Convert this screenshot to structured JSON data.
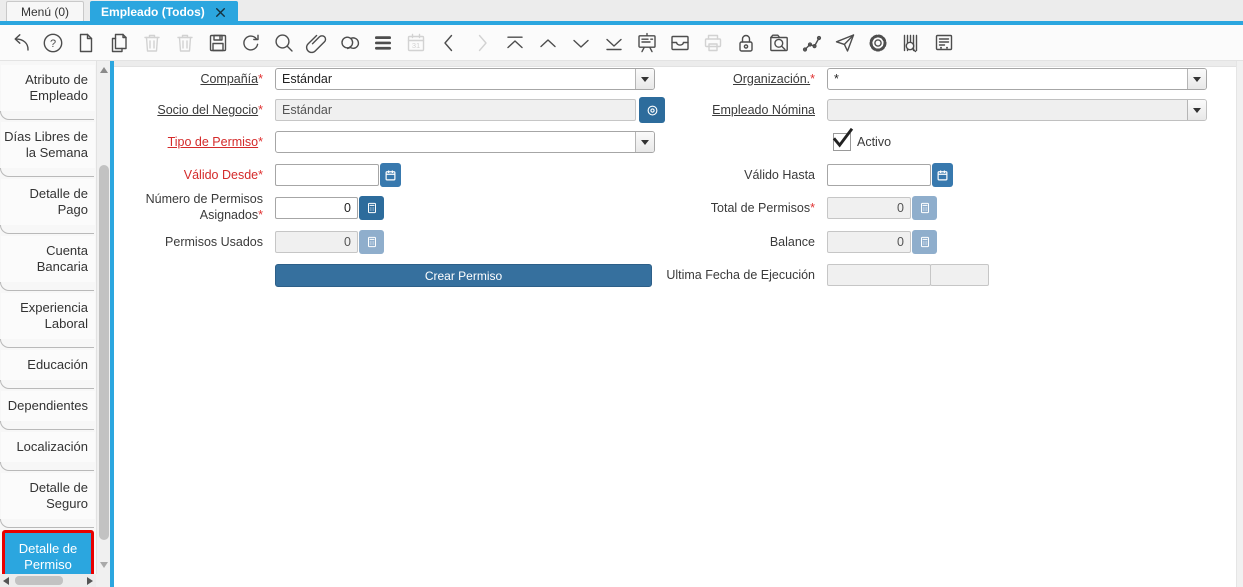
{
  "tab_bar": {
    "tabs": [
      {
        "label": "Menú (0)",
        "active": false
      },
      {
        "label": "Empleado (Todos)",
        "active": true,
        "closable": true
      }
    ]
  },
  "toolbar": {
    "items": [
      {
        "icon": "undo-icon",
        "disabled": false
      },
      {
        "icon": "help-icon",
        "disabled": false
      },
      {
        "icon": "new-record-icon",
        "disabled": false
      },
      {
        "icon": "copy-record-icon",
        "disabled": false
      },
      {
        "icon": "delete-record-icon",
        "disabled": true
      },
      {
        "icon": "delete-selection-icon",
        "disabled": true
      },
      {
        "icon": "save-icon",
        "disabled": false
      },
      {
        "icon": "refresh-icon",
        "disabled": false
      },
      {
        "icon": "find-icon",
        "disabled": false
      },
      {
        "icon": "attachment-icon",
        "disabled": false
      },
      {
        "icon": "chat-icon",
        "disabled": false
      },
      {
        "icon": "grid-toggle-icon",
        "disabled": false
      },
      {
        "icon": "calendar-icon",
        "disabled": true
      },
      {
        "icon": "previous-icon",
        "disabled": false
      },
      {
        "icon": "next-icon",
        "disabled": true
      },
      {
        "icon": "first-record-icon",
        "disabled": false
      },
      {
        "icon": "up-icon",
        "disabled": false
      },
      {
        "icon": "down-icon",
        "disabled": false
      },
      {
        "icon": "last-record-icon",
        "disabled": false
      },
      {
        "icon": "workflow-board-icon",
        "disabled": false
      },
      {
        "icon": "archive-icon",
        "disabled": false
      },
      {
        "icon": "print-icon",
        "disabled": true
      },
      {
        "icon": "lock-icon",
        "disabled": false
      },
      {
        "icon": "zoom-across-icon",
        "disabled": false
      },
      {
        "icon": "workflow-icon",
        "disabled": false
      },
      {
        "icon": "request-icon",
        "disabled": false
      },
      {
        "icon": "preferences-icon",
        "disabled": false
      },
      {
        "icon": "product-info-icon",
        "disabled": false
      },
      {
        "icon": "report-icon",
        "disabled": false
      }
    ]
  },
  "sidebar": {
    "items": [
      {
        "label": "Atributo de Empleado",
        "selected": false
      },
      {
        "label": "Días Libres de la Semana",
        "selected": false
      },
      {
        "label": "Detalle de Pago",
        "selected": false
      },
      {
        "label": "Cuenta Bancaria",
        "selected": false
      },
      {
        "label": "Experiencia Laboral",
        "selected": false
      },
      {
        "label": "Educación",
        "selected": false
      },
      {
        "label": "Dependientes",
        "selected": false
      },
      {
        "label": "Localización",
        "selected": false
      },
      {
        "label": "Detalle de Seguro",
        "selected": false
      },
      {
        "label": "Detalle de Permiso",
        "selected": true
      }
    ]
  },
  "form": {
    "fields": {
      "compania": {
        "label": "Compañía",
        "star": "*",
        "value": "Estándar"
      },
      "organizacion": {
        "label": "Organización.",
        "star": "*",
        "value": "*"
      },
      "socio_negocio": {
        "label": "Socio del Negocio",
        "star": "*",
        "value": "Estándar"
      },
      "empleado_nomina": {
        "label": "Empleado Nómina",
        "value": ""
      },
      "tipo_permiso": {
        "label": "Tipo de Permiso",
        "star": "*",
        "value": ""
      },
      "activo": {
        "label": "Activo",
        "checked": true
      },
      "valido_desde": {
        "label": "Válido Desde",
        "star": "*",
        "value": ""
      },
      "valido_hasta": {
        "label": "Válido Hasta",
        "value": ""
      },
      "numero_permisos_asignados": {
        "label": "Número de Permisos Asignados",
        "star": "*",
        "value": "0"
      },
      "total_permisos": {
        "label": "Total de Permisos",
        "star": "*",
        "value": "0"
      },
      "permisos_usados": {
        "label": "Permisos Usados",
        "value": "0"
      },
      "balance": {
        "label": "Balance",
        "value": "0"
      },
      "crear_permiso": {
        "label": "Crear Permiso"
      },
      "ultima_fecha_ejecucion": {
        "label": "Ultima Fecha de Ejecución",
        "value_date": "",
        "value_time": ""
      }
    }
  },
  "colors": {
    "accent_blue": "#2ba6df",
    "selected_tab_border_red": "#e80000",
    "action_button_blue": "#36709e",
    "field_button_blue": "#2d6c9c",
    "calendar_button_blue": "#3879ae",
    "disabled_button_blue": "#8faecc",
    "required_red": "#d42a2a"
  }
}
